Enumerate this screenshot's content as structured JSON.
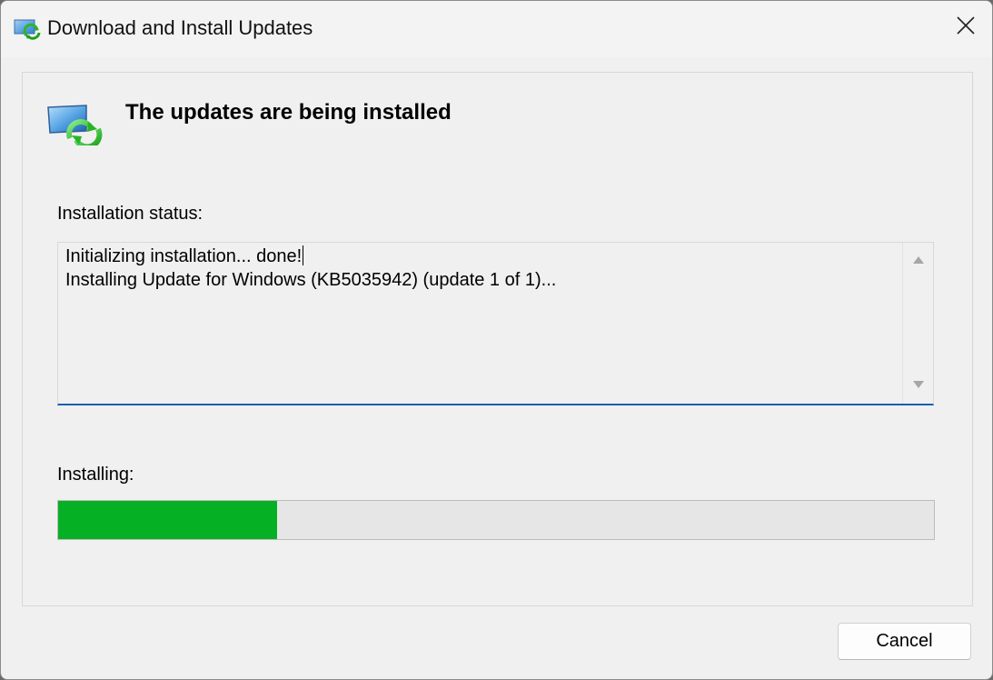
{
  "window": {
    "title": "Download and Install Updates",
    "icon": "windows-update-icon",
    "close_icon": "close-icon"
  },
  "header": {
    "icon": "windows-update-icon",
    "title": "The updates are being installed"
  },
  "status": {
    "label": "Installation status:",
    "lines": [
      "Initializing installation... done!",
      "Installing Update for Windows (KB5035942) (update 1 of 1)..."
    ]
  },
  "progress": {
    "label": "Installing:",
    "fraction": 0.25,
    "color": "#06b025"
  },
  "buttons": {
    "cancel_label": "Cancel"
  },
  "colors": {
    "accent": "#1a5fb4",
    "progress_fill": "#06b025",
    "window_bg": "#f0f0f0"
  }
}
